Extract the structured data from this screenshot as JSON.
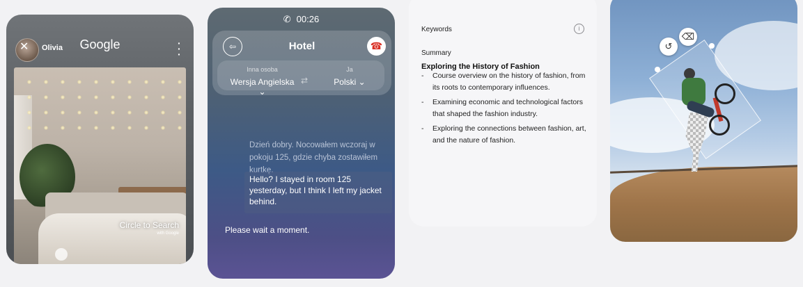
{
  "circle_to_search": {
    "user_name": "Olivia",
    "brand": "Google",
    "feature_name": "Circle to Search",
    "feature_sub": "with Google"
  },
  "interpreter": {
    "call_timer": "00:26",
    "title": "Hotel",
    "other_person_caption": "Inna osoba",
    "other_person_language": "Wersja Angielska",
    "me_caption": "Ja",
    "me_language": "Polski",
    "incoming_text": "Dzień dobry. Nocowałem wczoraj w pokoju 125, gdzie chyba zostawiłem kurtkę.",
    "translated_text": "Hello? I stayed in room 125 yesterday, but I think I left my jacket behind.",
    "outgoing_text": "Please wait a moment."
  },
  "notes": {
    "keywords_label": "Keywords",
    "summary_label": "Summary",
    "heading": "Exploring the History of Fashion",
    "bullets": [
      "Course overview on the history of fashion, from its roots to contemporary influences.",
      "Examining economic and technological factors that shaped the fashion industry.",
      "Exploring the connections between fashion, art, and the nature of fashion."
    ]
  },
  "photo_edit": {
    "tools": [
      "undo-icon",
      "eraser-icon"
    ]
  }
}
